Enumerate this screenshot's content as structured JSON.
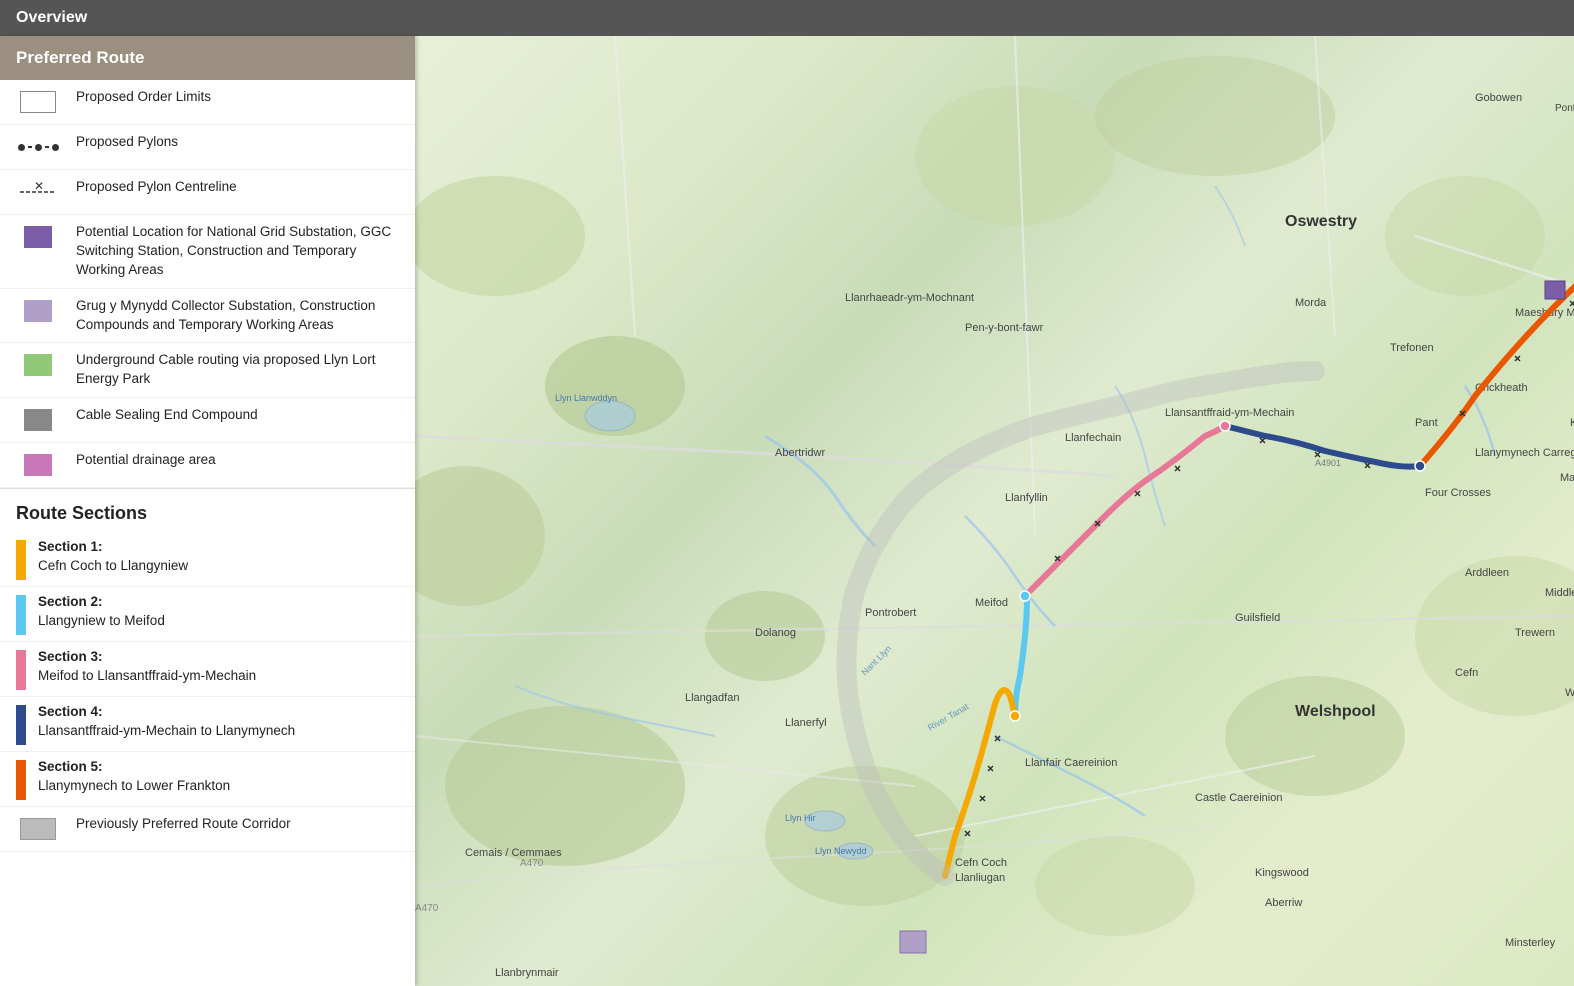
{
  "titleBar": {
    "label": "Overview"
  },
  "legend": {
    "preferredRouteHeader": "Preferred Route",
    "items": [
      {
        "id": "order-limits",
        "text": "Proposed Order Limits",
        "symbolType": "order-limits"
      },
      {
        "id": "proposed-pylons",
        "text": "Proposed Pylons",
        "symbolType": "pylons"
      },
      {
        "id": "pylon-centreline",
        "text": "Proposed Pylon Centreline",
        "symbolType": "centreline"
      },
      {
        "id": "ng-substation",
        "text": "Potential Location for National Grid Substation, GGC Switching Station, Construction and Temporary Working Areas",
        "symbolType": "purple"
      },
      {
        "id": "grug-substation",
        "text": "Grug y Mynydd Collector Substation, Construction Compounds and Temporary Working Areas",
        "symbolType": "lavender"
      },
      {
        "id": "underground-cable",
        "text": "Underground Cable routing via proposed Llyn Lort Energy Park",
        "symbolType": "green"
      },
      {
        "id": "cable-sealing",
        "text": "Cable Sealing End Compound",
        "symbolType": "gray"
      },
      {
        "id": "drainage",
        "text": "Potential drainage area",
        "symbolType": "pink"
      }
    ],
    "routeSectionsHeader": "Route Sections",
    "sections": [
      {
        "id": "section1",
        "label": "Section 1:",
        "desc": "Cefn Coch to Llangyniew",
        "color": "#F5A800"
      },
      {
        "id": "section2",
        "label": "Section 2:",
        "desc": "Llangyniew to Meifod",
        "color": "#5BC8F0"
      },
      {
        "id": "section3",
        "label": "Section 3:",
        "desc": "Meifod to Llansantffraid-ym-Mechain",
        "color": "#E87898"
      },
      {
        "id": "section4",
        "label": "Section 4:",
        "desc": "Llansantffraid-ym-Mechain to Llanymynech",
        "color": "#2C4A8C"
      },
      {
        "id": "section5",
        "label": "Section 5:",
        "desc": "Llanymynech to Lower Frankton",
        "color": "#E85800"
      }
    ],
    "prevCorridorLabel": "Previously Preferred Route Corridor",
    "prevCorridorSymbol": "gray-solid"
  }
}
